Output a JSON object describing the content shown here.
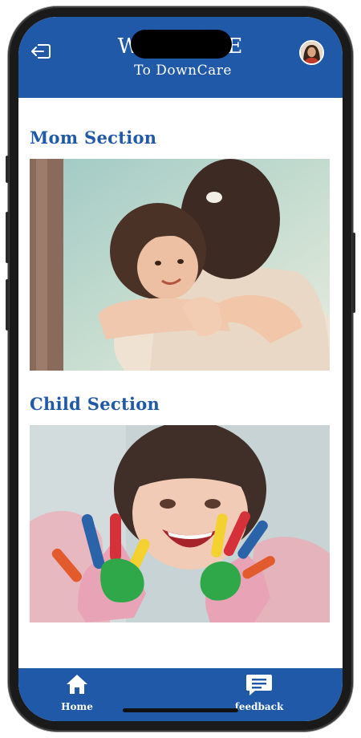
{
  "header": {
    "title_line1": "WELCOME",
    "title_line2": "To DownCare",
    "logout_icon": "logout-icon",
    "avatar_icon": "user-avatar"
  },
  "sections": [
    {
      "title": "Mom Section",
      "image": "mother-hugging-child-photo"
    },
    {
      "title": "Child Section",
      "image": "child-painted-hands-photo"
    }
  ],
  "bottom_nav": {
    "items": [
      {
        "label": "Home",
        "icon": "home-icon"
      },
      {
        "label": "feedback",
        "icon": "chat-bubble-icon"
      }
    ]
  },
  "colors": {
    "brand": "#2059a8",
    "background": "#ffffff"
  }
}
